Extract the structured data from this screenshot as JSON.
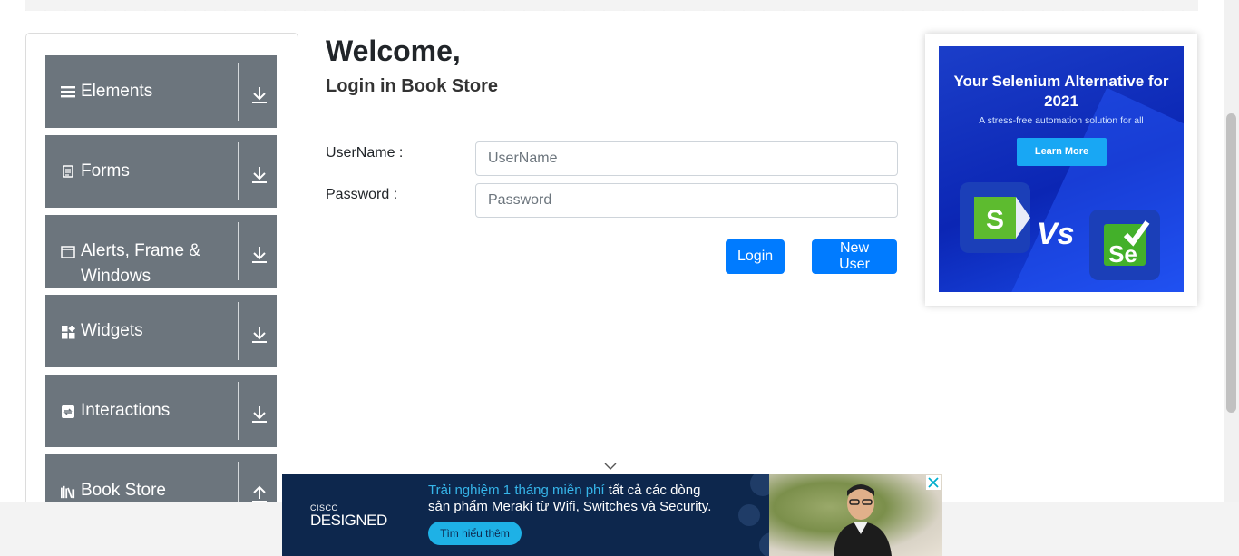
{
  "sidebar": {
    "groups": [
      {
        "label": "Elements",
        "icon": "hamburger-icon",
        "arrow": "down"
      },
      {
        "label": "Forms",
        "icon": "document-icon",
        "arrow": "down"
      },
      {
        "label": "Alerts, Frame & Windows",
        "icon": "window-icon",
        "arrow": "down"
      },
      {
        "label": "Widgets",
        "icon": "widgets-icon",
        "arrow": "down"
      },
      {
        "label": "Interactions",
        "icon": "interactions-icon",
        "arrow": "down"
      },
      {
        "label": "Book Store",
        "icon": "books-icon",
        "arrow": "up"
      }
    ]
  },
  "main": {
    "title": "Welcome,",
    "subtitle": "Login in Book Store",
    "username_label": "UserName :",
    "username_placeholder": "UserName",
    "username_value": "",
    "password_label": "Password :",
    "password_placeholder": "Password",
    "password_value": "",
    "login_label": "Login",
    "new_user_label": "New User"
  },
  "ad_right": {
    "title": "Your Selenium Alternative for 2021",
    "subtitle": "A stress-free automation solution for all",
    "button": "Learn More",
    "vs": "Vs",
    "logo_left": "S",
    "logo_right": "Se"
  },
  "ad_bottom": {
    "brand_small": "CISCO",
    "brand_big": "DESIGNED",
    "line1_highlight": "Trải nghiệm 1 tháng miễn phí",
    "line1_rest": " tất cả các dòng",
    "line2": "sản phẩm Meraki từ Wifi, Switches và Security.",
    "button": "Tìm hiểu thêm"
  },
  "colors": {
    "sidebar_bg": "#6c757d",
    "primary": "#007bff",
    "ad_blue": "#0b26b4",
    "ad_bottom_bg": "#0d274d"
  }
}
